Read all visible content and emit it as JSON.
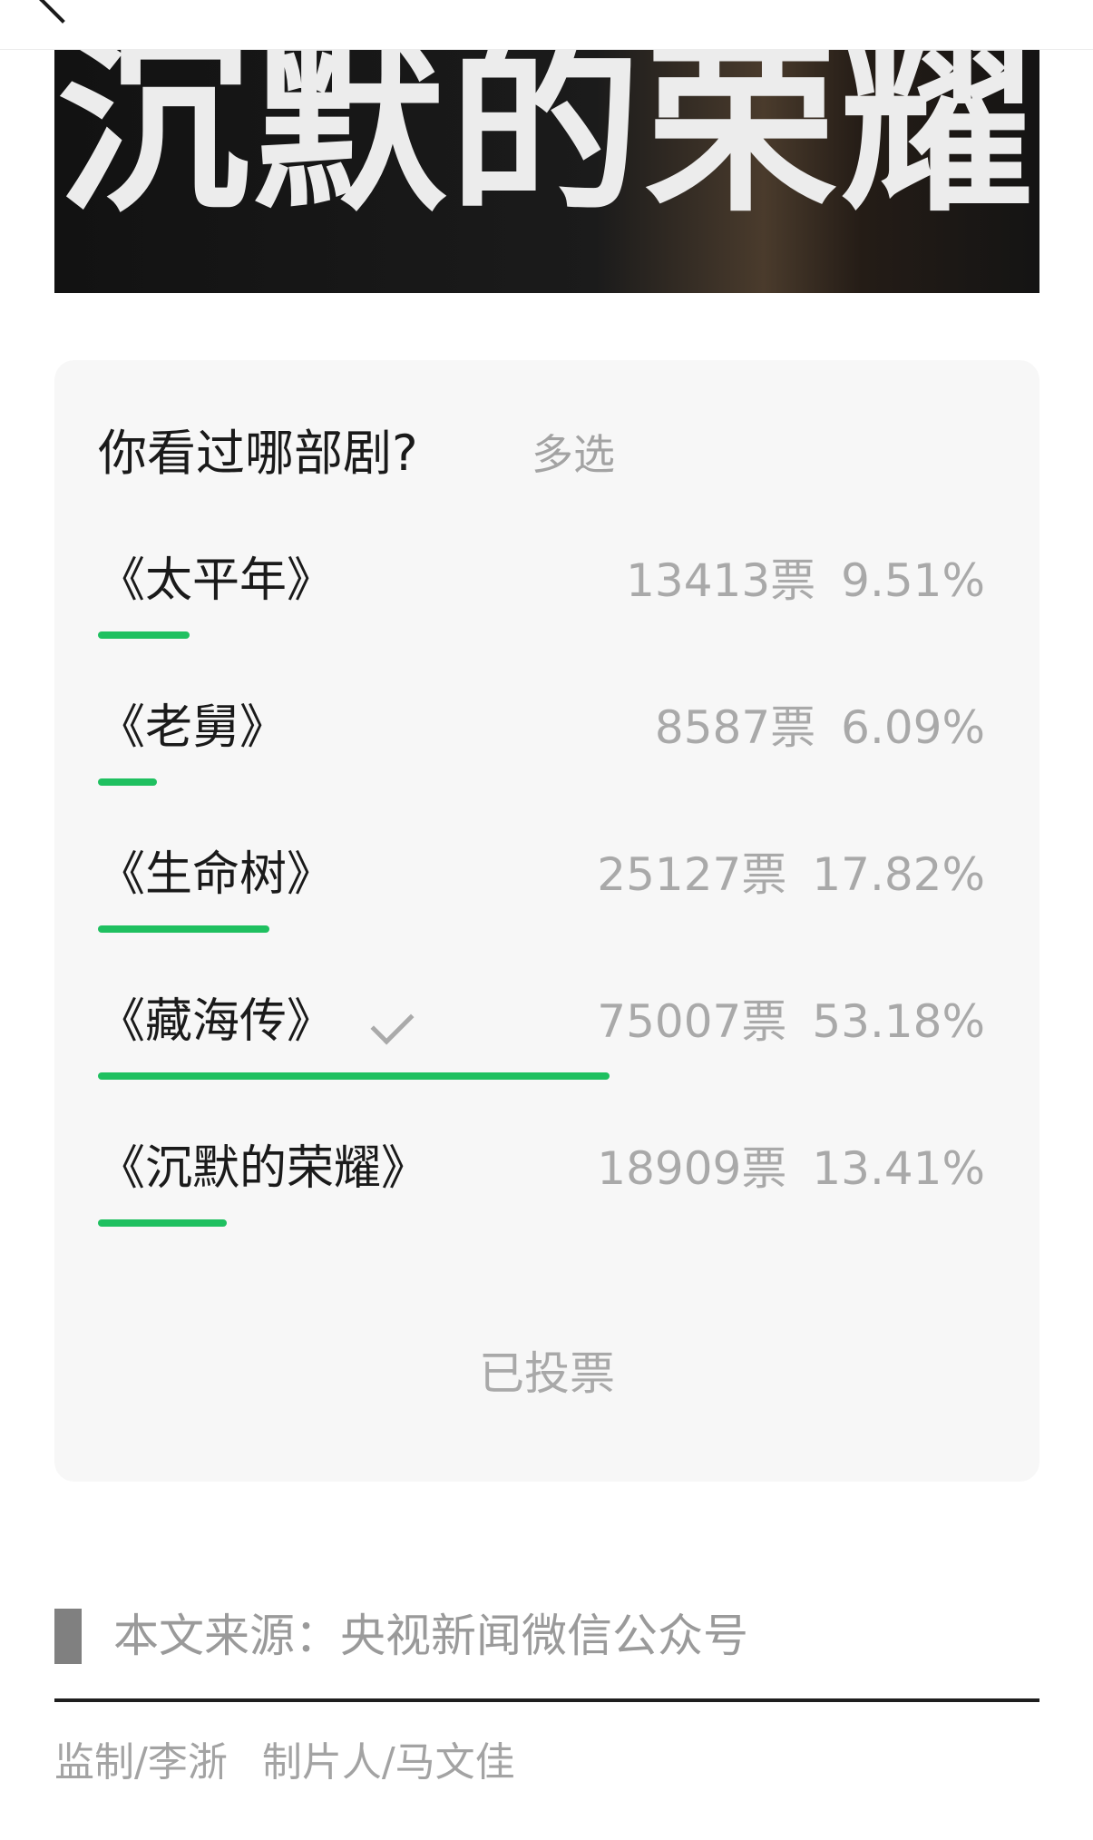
{
  "banner": {
    "title": "沉默的荣耀"
  },
  "poll": {
    "question": "你看过哪部剧?",
    "mode": "多选",
    "accent_color": "#1fc060",
    "options": [
      {
        "label": "《太平年》",
        "votes": "13413票",
        "percent": "9.51%",
        "fraction": 0.0951,
        "selected": false
      },
      {
        "label": "《老舅》",
        "votes": "8587票",
        "percent": "6.09%",
        "fraction": 0.0609,
        "selected": false
      },
      {
        "label": "《生命树》",
        "votes": "25127票",
        "percent": "17.82%",
        "fraction": 0.1782,
        "selected": false
      },
      {
        "label": "《藏海传》",
        "votes": "75007票",
        "percent": "53.18%",
        "fraction": 0.5318,
        "selected": true,
        "icon": "check-icon"
      },
      {
        "label": "《沉默的荣耀》",
        "votes": "18909票",
        "percent": "13.41%",
        "fraction": 0.1341,
        "selected": false
      }
    ],
    "status": "已投票"
  },
  "article": {
    "source": "本文来源：央视新闻微信公众号",
    "credits": [
      "监制/李浙",
      "制片人/马文佳"
    ]
  },
  "icons": {
    "top_bar": "back-icon"
  }
}
